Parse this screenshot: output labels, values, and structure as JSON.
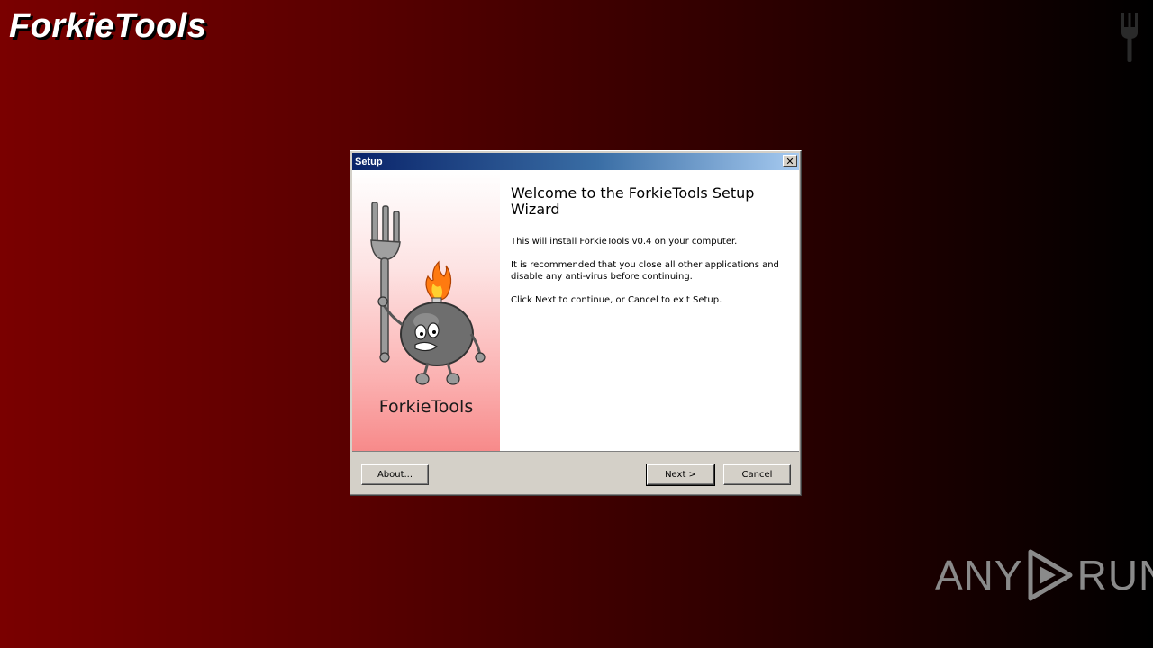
{
  "desktop": {
    "app_title": "ForkieTools",
    "watermark": {
      "left": "ANY",
      "right": "RUN"
    }
  },
  "dialog": {
    "title": "Setup",
    "close_label": "✕",
    "side_brand": "ForkieTools",
    "heading": "Welcome to the ForkieTools Setup Wizard",
    "paragraphs": [
      "This will install ForkieTools v0.4 on your computer.",
      "It is recommended that you close all other applications and disable any anti-virus before continuing.",
      "Click Next to continue, or Cancel to exit Setup."
    ],
    "buttons": {
      "about": "About...",
      "next": "Next >",
      "cancel": "Cancel"
    }
  },
  "colors": {
    "desktop_left": "#7a0000",
    "desktop_right": "#000000",
    "titlebar_start": "#0a246a",
    "titlebar_end": "#a6caf0",
    "side_panel_bottom": "#f78a8a"
  },
  "icons": [
    "fork-icon",
    "close-icon",
    "play-logo-icon"
  ]
}
